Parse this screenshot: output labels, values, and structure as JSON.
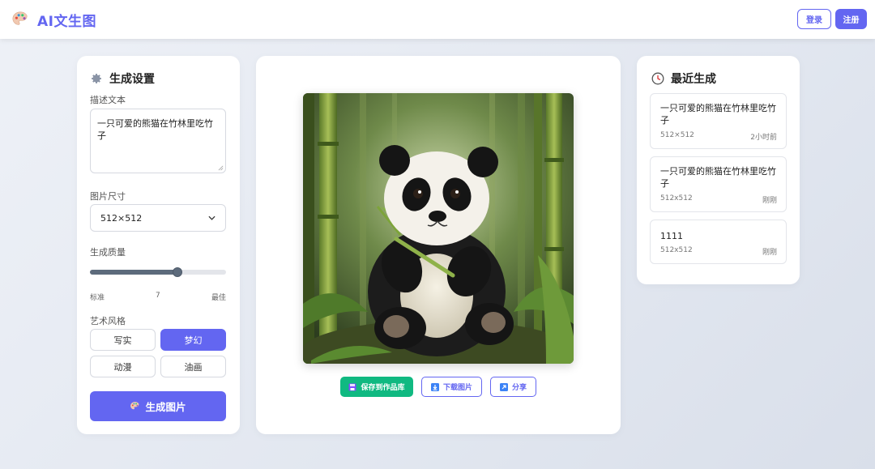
{
  "header": {
    "app_title": "AI文生图",
    "login_label": "登录",
    "register_label": "注册"
  },
  "settings": {
    "title": "生成设置",
    "prompt_label": "描述文本",
    "prompt_value": "一只可爱的熊猫在竹林里吃竹子",
    "size_label": "图片尺寸",
    "size_value": "512×512",
    "quality_label": "生成质量",
    "quality_min_label": "标准",
    "quality_value": "7",
    "quality_max_label": "最佳",
    "quality_fraction": 0.64,
    "style_label": "艺术风格",
    "styles": [
      {
        "label": "写实",
        "active": false
      },
      {
        "label": "梦幻",
        "active": true
      },
      {
        "label": "动漫",
        "active": false
      },
      {
        "label": "油画",
        "active": false
      }
    ],
    "generate_label": "生成图片"
  },
  "preview": {
    "save_label": "保存到作品库",
    "download_label": "下载图片",
    "share_label": "分享"
  },
  "history": {
    "title": "最近生成",
    "items": [
      {
        "prompt": "一只可爱的熊猫在竹林里吃竹子",
        "size": "512×512",
        "time": "2小时前"
      },
      {
        "prompt": "一只可爱的熊猫在竹林里吃竹子",
        "size": "512x512",
        "time": "刚刚"
      },
      {
        "prompt": "1111",
        "size": "512x512",
        "time": "刚刚"
      }
    ]
  },
  "colors": {
    "accent": "#6366f1",
    "save_green": "#10b981"
  }
}
